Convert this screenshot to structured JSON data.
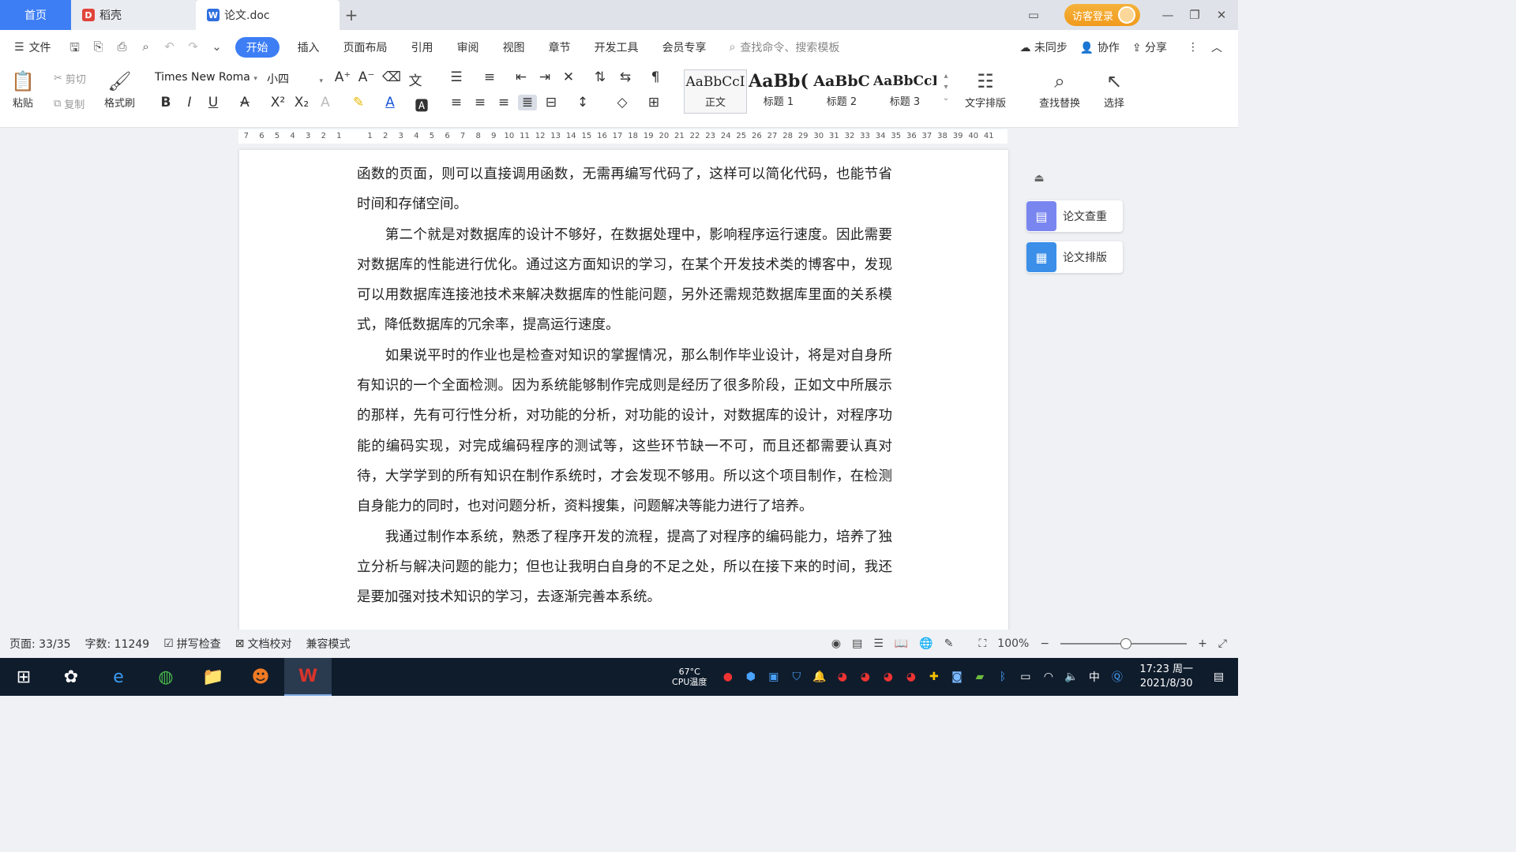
{
  "tabs": {
    "home": "首页",
    "daoke": "稻壳",
    "doc": "论文.doc",
    "add": "+"
  },
  "titlebar": {
    "login": "访客登录",
    "minimize": "—",
    "restore": "❐",
    "close": "✕"
  },
  "menu": {
    "file": "文件",
    "items": [
      "开始",
      "插入",
      "页面布局",
      "引用",
      "审阅",
      "视图",
      "章节",
      "开发工具",
      "会员专享"
    ],
    "search_placeholder": "查找命令、搜索模板",
    "sync": "未同步",
    "collab": "协作",
    "share": "分享"
  },
  "ribbon": {
    "paste": "粘贴",
    "cut": "剪切",
    "copy": "复制",
    "format_painter": "格式刷",
    "font_name": "Times New Roma",
    "font_size": "小四",
    "styles": [
      {
        "sample": "AaBbCcI",
        "name": "正文"
      },
      {
        "sample": "AaBb(",
        "name": "标题 1"
      },
      {
        "sample": "AaBbC",
        "name": "标题 2"
      },
      {
        "sample": "AaBbCcI",
        "name": "标题 3"
      }
    ],
    "text_layout": "文字排版",
    "find_replace": "查找替换",
    "select": "选择"
  },
  "ruler": {
    "numbers": [
      "7",
      "6",
      "5",
      "4",
      "3",
      "2",
      "1",
      "",
      "1",
      "2",
      "3",
      "4",
      "5",
      "6",
      "7",
      "8",
      "9",
      "10",
      "11",
      "12",
      "13",
      "14",
      "15",
      "16",
      "17",
      "18",
      "19",
      "20",
      "21",
      "22",
      "23",
      "24",
      "25",
      "26",
      "27",
      "28",
      "29",
      "30",
      "31",
      "32",
      "33",
      "34",
      "35",
      "36",
      "37",
      "38",
      "39",
      "40",
      "41"
    ]
  },
  "document": {
    "paragraphs": [
      "函数的页面，则可以直接调用函数，无需再编写代码了，这样可以简化代码，也能节省时间和存储空间。",
      "　　第二个就是对数据库的设计不够好，在数据处理中，影响程序运行速度。因此需要对数据库的性能进行优化。通过这方面知识的学习，在某个开发技术类的博客中，发现可以用数据库连接池技术来解决数据库的性能问题，另外还需规范数据库里面的关系模式，降低数据库的冗余率，提高运行速度。",
      "　　如果说平时的作业也是检查对知识的掌握情况，那么制作毕业设计，将是对自身所有知识的一个全面检测。因为系统能够制作完成则是经历了很多阶段，正如文中所展示的那样，先有可行性分析，对功能的分析，对功能的设计，对数据库的设计，对程序功能的编码实现，对完成编码程序的测试等，这些环节缺一不可，而且还都需要认真对待，大学学到的所有知识在制作系统时，才会发现不够用。所以这个项目制作，在检测自身能力的同时，也对问题分析，资料搜集，问题解决等能力进行了培养。",
      "　　我通过制作本系统，熟悉了程序开发的流程，提高了对程序的编码能力，培养了独立分析与解决问题的能力；但也让我明白自身的不足之处，所以在接下来的时间，我还是要加强对技术知识的学习，去逐渐完善本系统。"
    ]
  },
  "side_panel": {
    "check": "论文查重",
    "format": "论文排版"
  },
  "status": {
    "page": "页面: 33/35",
    "words": "字数: 11249",
    "spellcheck": "拼写检查",
    "proofread": "文档校对",
    "compat": "兼容模式",
    "zoom": "100%"
  },
  "taskbar": {
    "cpu_temp": "CPU温度",
    "cpu_value": "67°C",
    "ime": "中",
    "time": "17:23 周一",
    "date": "2021/8/30"
  },
  "colors": {
    "accent": "#3d7ef5",
    "wps_red": "#d9342b",
    "login_orange": "#f09a1c"
  }
}
